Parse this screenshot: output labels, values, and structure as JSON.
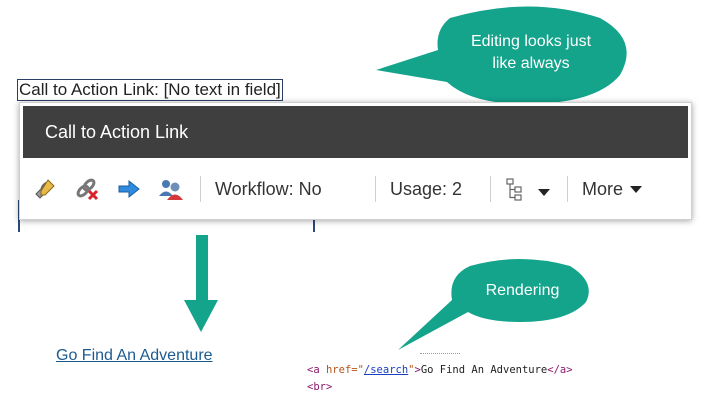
{
  "field": {
    "label": "Call to Action Link: [No text in field]"
  },
  "toolbar": {
    "title": "Call to Action Link",
    "icons": [
      "edit-link-icon",
      "remove-link-icon",
      "go-to-link-icon",
      "users-icon"
    ],
    "workflow_label": "Workflow: No",
    "usage_label": "Usage: 2",
    "tree_icon": "tree-icon",
    "more_label": "More"
  },
  "callouts": {
    "editing_line1": "Editing looks just",
    "editing_line2": "like always",
    "rendering": "Rendering"
  },
  "rendered": {
    "link_text": "Go Find An Adventure"
  },
  "markup": {
    "tag_open": "<a ",
    "attr_name": "href=",
    "quote": "\"",
    "href": "/search",
    "tag_close_open": ">",
    "text": "Go Find An Adventure",
    "tag_end": "</a>",
    "br": "<br>"
  },
  "colors": {
    "callout": "#14a38b",
    "toolbar_header": "#3f3f3f",
    "link": "#1d5b8f"
  }
}
